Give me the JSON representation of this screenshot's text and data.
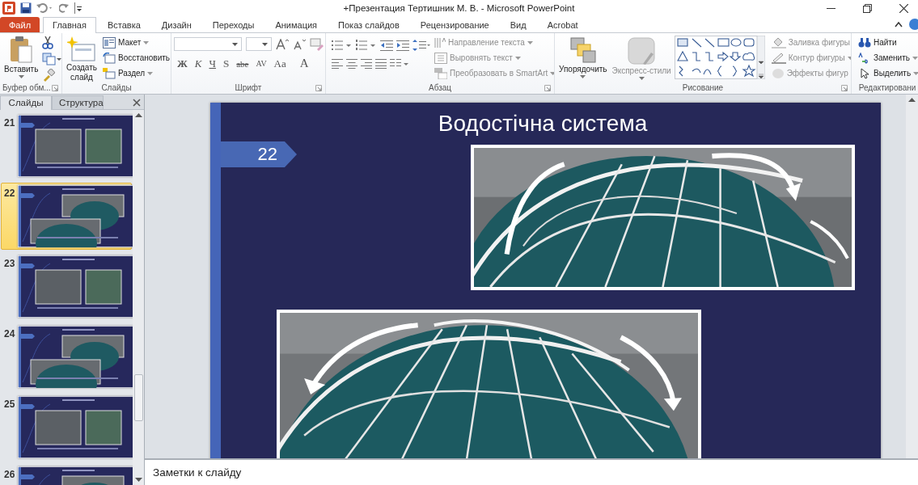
{
  "window": {
    "title": "+Презентация Тертишник  М. В.  -  Microsoft PowerPoint"
  },
  "tabs": [
    {
      "label": "Файл",
      "kind": "file",
      "selected": false
    },
    {
      "label": "Главная",
      "kind": "tab",
      "selected": true
    },
    {
      "label": "Вставка",
      "kind": "tab",
      "selected": false
    },
    {
      "label": "Дизайн",
      "kind": "tab",
      "selected": false
    },
    {
      "label": "Переходы",
      "kind": "tab",
      "selected": false
    },
    {
      "label": "Анимация",
      "kind": "tab",
      "selected": false
    },
    {
      "label": "Показ слайдов",
      "kind": "tab",
      "selected": false
    },
    {
      "label": "Рецензирование",
      "kind": "tab",
      "selected": false
    },
    {
      "label": "Вид",
      "kind": "tab",
      "selected": false
    },
    {
      "label": "Acrobat",
      "kind": "tab",
      "selected": false
    }
  ],
  "ribbon_groups": [
    {
      "kind": "clipboard",
      "label": "Буфер обм...",
      "large": [
        {
          "label": "Вставить",
          "kind": "paste",
          "disabled": false
        }
      ]
    },
    {
      "kind": "slides",
      "label": "Слайды",
      "large": [
        {
          "label": "Создать слайд",
          "kind": "new-slide",
          "disabled": false
        }
      ],
      "small": [
        {
          "label": "Макет",
          "kind": "layout",
          "disabled": false
        },
        {
          "label": "Восстановить",
          "kind": "reset",
          "disabled": false
        },
        {
          "label": "Раздел",
          "kind": "section",
          "disabled": false
        }
      ]
    },
    {
      "kind": "font",
      "label": "Шрифт",
      "format": [
        "Ж",
        "К",
        "Ч",
        "S",
        "abe",
        "AV",
        "Aa",
        "A"
      ]
    },
    {
      "kind": "paragraph",
      "label": "Абзац",
      "small": [
        {
          "label": "Направление текста",
          "kind": "text-direction",
          "disabled": true
        },
        {
          "label": "Выровнять текст",
          "kind": "align-text",
          "disabled": true
        },
        {
          "label": "Преобразовать в SmartArt",
          "kind": "smartart",
          "disabled": true
        }
      ]
    },
    {
      "kind": "drawing",
      "label": "Рисование",
      "large": [
        {
          "label": "Упорядочить",
          "kind": "arrange",
          "disabled": false
        },
        {
          "label": "Экспресс-стили",
          "kind": "styles",
          "disabled": true
        }
      ],
      "small": [
        {
          "label": "Заливка фигуры",
          "kind": "fill",
          "disabled": true
        },
        {
          "label": "Контур фигуры",
          "kind": "outline",
          "disabled": true
        },
        {
          "label": "Эффекты фигур",
          "kind": "effects",
          "disabled": true
        }
      ]
    },
    {
      "kind": "editing",
      "label": "Редактировани",
      "small": [
        {
          "label": "Найти",
          "kind": "find",
          "disabled": false
        },
        {
          "label": "Заменить",
          "kind": "replace",
          "disabled": false
        },
        {
          "label": "Выделить",
          "kind": "select",
          "disabled": false
        }
      ]
    }
  ],
  "panel_tabs": [
    {
      "label": "Слайды",
      "selected": true
    },
    {
      "label": "Структура",
      "selected": false
    }
  ],
  "thumbnails": [
    {
      "number": "21",
      "selected": false
    },
    {
      "number": "22",
      "selected": true
    },
    {
      "number": "23",
      "selected": false
    },
    {
      "number": "24",
      "selected": false
    },
    {
      "number": "25",
      "selected": false
    },
    {
      "number": "26",
      "selected": false
    }
  ],
  "slide": {
    "title": "Водостічна система",
    "number": "22"
  },
  "notes": {
    "placeholder": "Заметки к слайду"
  }
}
